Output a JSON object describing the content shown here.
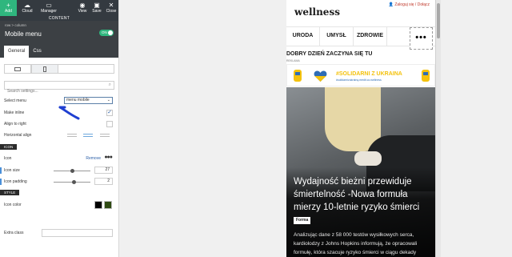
{
  "toolbar": {
    "add": "Add",
    "cloud": "Cloud",
    "manager": "Manager",
    "view": "View",
    "save": "Save",
    "close": "Close"
  },
  "content_label": "CONTENT",
  "breadcrumb": "row > column",
  "element_title": "Mobile menu",
  "toggle_label": "ON",
  "tabs": [
    "General",
    "Css"
  ],
  "search": {
    "placeholder": "Search settings..."
  },
  "fields": {
    "select_menu_label": "Select menu",
    "select_menu_value": "menu mobile",
    "make_inline_label": "Make inline",
    "align_right_label": "Align to right",
    "horizontal_align_label": "Horizontal align",
    "icon_section": "ICON",
    "icon_label": "Icon",
    "remove_label": "Remove",
    "icon_size_label": "Icon size",
    "icon_size_value": "27",
    "icon_size_level": 0.5,
    "icon_padding_label": "Icon padding",
    "icon_padding_value": "2",
    "icon_padding_level": 0.55,
    "style_section": "STYLE",
    "icon_color_label": "Icon color",
    "icon_color_1": "#000000",
    "icon_color_2": "#2e4a12",
    "extra_class_label": "Extra class"
  },
  "preview": {
    "logo": "wellness",
    "login": "Zaloguj się / Dołącz",
    "nav": [
      "URODA",
      "UMYSŁ",
      "ZDROWIE"
    ],
    "greeting": "DOBRY DZIEŃ ZACZYNA SIĘ TU",
    "ad_label": "REKLAMA",
    "banner_title": "#SOLIDARNI Z UKRAINA",
    "banner_sub": "#solidarnizukrainą.medit.co.wellness",
    "hero_title": "Wydajność bieżni przewiduje śmiertelność -Nowa formuła mierzy 10-letnie ryzyko śmierci",
    "hero_tag": "Forma",
    "hero_lead": "Analizując dane z 58 000 testów wysiłkowych serca, kardiolodzy z Johns Hopkins informują, że opracowali formułę, która szacuje ryzyko śmierci w ciągu dekady"
  },
  "colors": {
    "accent_green": "#2fb67e",
    "panel_dark": "#343a40",
    "banner_yellow": "#f4c20d",
    "banner_blue": "#2f6db5"
  }
}
